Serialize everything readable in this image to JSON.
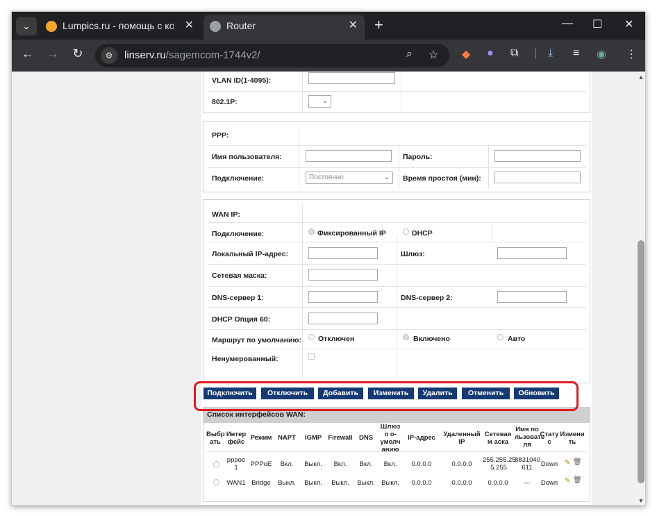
{
  "browser": {
    "tabs": [
      {
        "title": "Lumpics.ru - помощь с компь",
        "favicon": "orange-circle-icon"
      },
      {
        "title": "Router",
        "favicon": "globe-icon"
      }
    ],
    "address": {
      "host": "linserv.ru",
      "path": "/sagemcom-1744v2/"
    }
  },
  "vlan": {
    "vlan_id_label": "VLAN ID(1-4095):",
    "priority_label": "802.1P:"
  },
  "ppp": {
    "section_label": "PPP:",
    "username_label": "Имя пользователя:",
    "password_label": "Пароль:",
    "connection_label": "Подключение:",
    "connection_value": "Постоянно",
    "idle_label": "Время простоя (мин):"
  },
  "wanip": {
    "section_label": "WAN IP:",
    "connection_label": "Подключение:",
    "fixed_ip_label": "Фиксированный IP",
    "dhcp_label": "DHCP",
    "local_ip_label": "Локальный IP-адрес:",
    "gateway_label": "Шлюз:",
    "netmask_label": "Сетевая маска:",
    "dns1_label": "DNS-сервер 1:",
    "dns2_label": "DNS-сервер 2:",
    "dhcp60_label": "DHCP Опция 60:",
    "default_route_label": "Маршрут по умолчанию:",
    "route_off": "Отключен",
    "route_on": "Включено",
    "route_auto": "Авто",
    "unnumbered_label": "Ненумерованный:"
  },
  "buttons": [
    "Подключить",
    "Отключить",
    "Добавить",
    "Изменить",
    "Удалить",
    "Отменить",
    "Обновить"
  ],
  "wan_list": {
    "title": "Список интерфейсов WAN:",
    "columns": [
      "Выбр ать",
      "Интер фейс",
      "Режим",
      "NAPT",
      "IGMP",
      "Firewall",
      "DNS",
      "Шлюз п о-умолч анию",
      "IP-адрес",
      "Удаленный IP",
      "Сетевая м аска",
      "Имя по льзовате ля",
      "Стату с",
      "Измени ть"
    ],
    "rows": [
      {
        "iface": "pppoe 1",
        "mode": "PPPoE",
        "napt": "Вкл.",
        "igmp": "Выкл.",
        "firewall": "Вкл.",
        "dns": "Вкл.",
        "gw": "Вкл.",
        "ip": "0.0.0.0",
        "remote": "0.0.0.0",
        "mask": "255.255.25 5.255",
        "user": "8831040 611",
        "status": "Down"
      },
      {
        "iface": "WAN1",
        "mode": "Bridge",
        "napt": "Выкл.",
        "igmp": "Выкл.",
        "firewall": "Выкл.",
        "dns": "Выкл.",
        "gw": "Выкл.",
        "ip": "0.0.0.0",
        "remote": "0.0.0.0",
        "mask": "0.0.0.0",
        "user": "---",
        "status": "Down"
      }
    ]
  },
  "highlight_color": "#e0191e",
  "button_color": "#153a73"
}
